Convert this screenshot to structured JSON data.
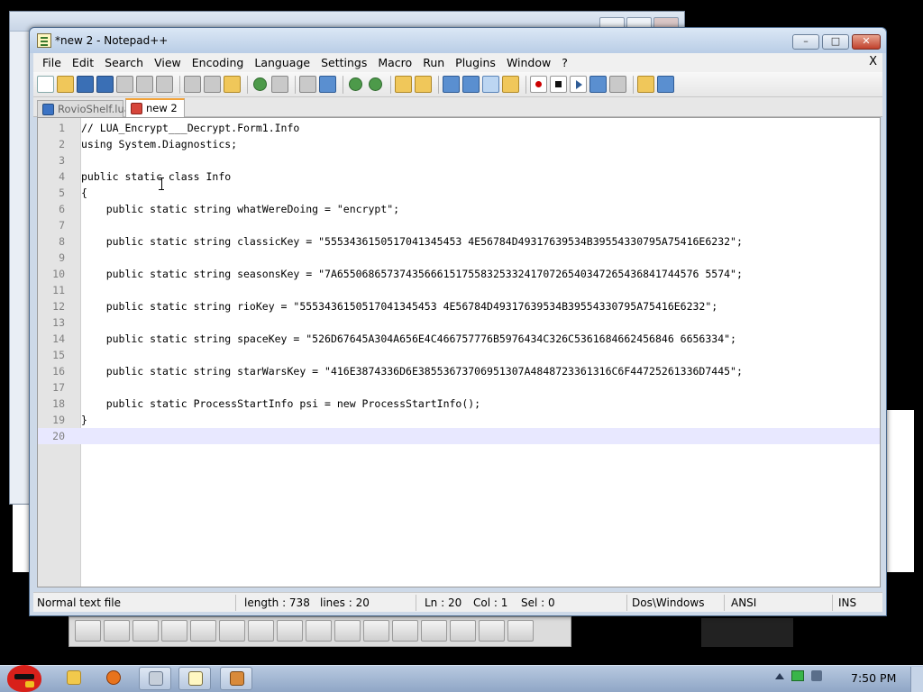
{
  "window": {
    "title": "*new  2 - Notepad++",
    "controls": {
      "minimize": "–",
      "maximize": "□",
      "close": "✕"
    }
  },
  "menu": {
    "items": [
      "File",
      "Edit",
      "Search",
      "View",
      "Encoding",
      "Language",
      "Settings",
      "Macro",
      "Run",
      "Plugins",
      "Window",
      "?"
    ],
    "close_doc": "X"
  },
  "tabs": [
    {
      "label": "RovioShelf.lua",
      "active": false
    },
    {
      "label": "new  2",
      "active": true
    }
  ],
  "editor": {
    "lines": [
      {
        "n": "1",
        "code": "// LUA_Encrypt___Decrypt.Form1.Info"
      },
      {
        "n": "2",
        "code": "using System.Diagnostics;"
      },
      {
        "n": "3",
        "code": ""
      },
      {
        "n": "4",
        "code": "public static class Info"
      },
      {
        "n": "5",
        "code": "{"
      },
      {
        "n": "6",
        "code": "    public static string whatWereDoing = \"encrypt\";"
      },
      {
        "n": "7",
        "code": ""
      },
      {
        "n": "8",
        "code": "    public static string classicKey = \"5553436150517041345453 4E56784D49317639534B39554330795A75416E6232\";"
      },
      {
        "n": "9",
        "code": ""
      },
      {
        "n": "10",
        "code": "    public static string seasonsKey = \"7A6550686573743566615175583253324170726540347265436841744576 5574\";"
      },
      {
        "n": "11",
        "code": ""
      },
      {
        "n": "12",
        "code": "    public static string rioKey = \"5553436150517041345453 4E56784D49317639534B39554330795A75416E6232\";"
      },
      {
        "n": "13",
        "code": ""
      },
      {
        "n": "14",
        "code": "    public static string spaceKey = \"526D67645A304A656E4C466757776B5976434C326C5361684662456846 6656334\";"
      },
      {
        "n": "15",
        "code": ""
      },
      {
        "n": "16",
        "code": "    public static string starWarsKey = \"416E3874336D6E38553673706951307A4848723361316C6F44725261336D7445\";"
      },
      {
        "n": "17",
        "code": ""
      },
      {
        "n": "18",
        "code": "    public static ProcessStartInfo psi = new ProcessStartInfo();"
      },
      {
        "n": "19",
        "code": "}"
      },
      {
        "n": "20",
        "code": ""
      }
    ]
  },
  "status": {
    "filetype": "Normal text file",
    "length": "length : 738",
    "lines": "lines : 20",
    "ln": "Ln : 20",
    "col": "Col : 1",
    "sel": "Sel : 0",
    "eol": "Dos\\Windows",
    "encoding": "ANSI",
    "mode": "INS"
  },
  "taskbar": {
    "clock": "7:50 PM"
  },
  "colors": {
    "current_line": "#e8e8ff",
    "tab_active_accent": "#f2a33a"
  }
}
